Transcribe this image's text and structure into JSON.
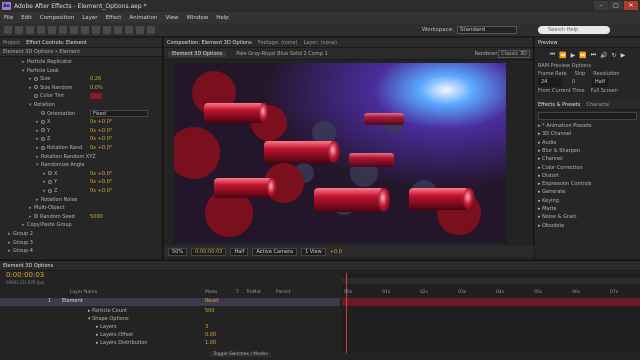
{
  "window": {
    "title": "Adobe After Effects - Element_Options.aep *",
    "logo": "Ae",
    "controls": [
      "–",
      "□",
      "✕"
    ]
  },
  "menu": [
    "File",
    "Edit",
    "Composition",
    "Layer",
    "Effect",
    "Animation",
    "View",
    "Window",
    "Help"
  ],
  "toolbar": {
    "workspace_label": "Workspace:",
    "workspace_value": "Standard",
    "search_placeholder": "Search Help"
  },
  "effect_controls": {
    "tabs": [
      "Project",
      "Effect Controls: Element"
    ],
    "subtitle": "Element 3D Options • Element",
    "rows": [
      {
        "label": "Particle Replicator",
        "indent": 0,
        "arrow": "▸",
        "value": ""
      },
      {
        "label": "Particle Look",
        "indent": 0,
        "arrow": "▾",
        "value": ""
      },
      {
        "label": "Size",
        "indent": 1,
        "arrow": "▸",
        "sw": true,
        "value": "0.26"
      },
      {
        "label": "Size Random",
        "indent": 1,
        "arrow": "▸",
        "sw": true,
        "value": "0.0%"
      },
      {
        "label": "Color Tint",
        "indent": 1,
        "arrow": "",
        "sw": true,
        "value": "",
        "swatch": "#8b1a22"
      },
      {
        "label": "Rotation",
        "indent": 1,
        "arrow": "▾",
        "value": ""
      },
      {
        "label": "Orientation",
        "indent": 2,
        "arrow": "",
        "sw": true,
        "value": "Fixed",
        "dropdown": true
      },
      {
        "label": "X",
        "indent": 2,
        "arrow": "▸",
        "sw": true,
        "value": "0x +0.0°"
      },
      {
        "label": "Y",
        "indent": 2,
        "arrow": "▸",
        "sw": true,
        "value": "0x +0.0°"
      },
      {
        "label": "Z",
        "indent": 2,
        "arrow": "▸",
        "sw": true,
        "value": "0x +0.0°"
      },
      {
        "label": "Rotation Rand",
        "indent": 2,
        "arrow": "▸",
        "sw": true,
        "value": "0x +0.0°"
      },
      {
        "label": "Rotation Random XYZ",
        "indent": 2,
        "arrow": "▸",
        "value": ""
      },
      {
        "label": "Randomize Angle",
        "indent": 2,
        "arrow": "▾",
        "value": ""
      },
      {
        "label": "X",
        "indent": 3,
        "arrow": "▸",
        "sw": true,
        "value": "0x +0.0°"
      },
      {
        "label": "Y",
        "indent": 3,
        "arrow": "▸",
        "sw": true,
        "value": "0x +0.0°"
      },
      {
        "label": "Z",
        "indent": 3,
        "arrow": "▸",
        "sw": true,
        "value": "0x +0.0°"
      },
      {
        "label": "Rotation Noise",
        "indent": 2,
        "arrow": "▸",
        "value": ""
      },
      {
        "label": "Multi-Object",
        "indent": 1,
        "arrow": "▸",
        "value": ""
      },
      {
        "label": "Random Seed",
        "indent": 1,
        "arrow": "▸",
        "sw": true,
        "value": "5000"
      },
      {
        "label": "Copy/Paste Group",
        "indent": 0,
        "arrow": "▸",
        "value": ""
      },
      {
        "label": "Group 2",
        "indent": -1,
        "arrow": "▸",
        "value": ""
      },
      {
        "label": "Group 3",
        "indent": -1,
        "arrow": "▸",
        "value": ""
      },
      {
        "label": "Group 4",
        "indent": -1,
        "arrow": "▸",
        "value": ""
      }
    ]
  },
  "composition": {
    "tabs": [
      "Composition: Element 3D Options",
      "Footage: (none)",
      "Layer: (none)"
    ],
    "subtabs": [
      "Element 3D Options",
      "Pale Gray-Royal Blue Solid 2 Comp 1"
    ],
    "renderer_label": "Renderer:",
    "renderer_value": "Classic 3D",
    "footer": {
      "zoom": "50%",
      "timecode": "0:00:00:03",
      "resolution": "Half",
      "camera": "Active Camera",
      "views": "1 View",
      "exposure": "+0.0"
    }
  },
  "preview": {
    "title": "Preview",
    "ram_options": "RAM Preview Options",
    "frame_rate_label": "Frame Rate",
    "skip_label": "Skip",
    "resolution_label": "Resolution",
    "frame_rate_value": "24",
    "skip_value": "0",
    "resolution_value": "Half",
    "from_current": "From Current Time",
    "full_screen": "Full Screen"
  },
  "effects_presets": {
    "tabs": [
      "Effects & Presets",
      "Characte"
    ],
    "items": [
      "* Animation Presets",
      "3D Channel",
      "Audio",
      "Blur & Sharpen",
      "Channel",
      "Color Correction",
      "Distort",
      "Expression Controls",
      "Generate",
      "Keying",
      "Matte",
      "Noise & Grain",
      "Obsolete"
    ]
  },
  "timeline": {
    "tab": "Element 3D Options",
    "timecode": "0:00:00:03",
    "fps": "00003 (23.976 fps)",
    "columns": [
      "Layer Name",
      "Mode",
      "T",
      "TrkMat",
      "Parent"
    ],
    "layer_row": {
      "num": "1",
      "name": "Element",
      "mode": "Reset",
      "parent": ""
    },
    "rows": [
      {
        "label": "Particle Count",
        "indent": 1,
        "value": "500"
      },
      {
        "label": "Shape Options",
        "indent": 1,
        "value": ""
      },
      {
        "label": "Layers",
        "indent": 2,
        "value": "3"
      },
      {
        "label": "Layers Offset",
        "indent": 2,
        "value": "0.00"
      },
      {
        "label": "Layers Distribution",
        "indent": 2,
        "value": "1.00"
      }
    ],
    "ruler": [
      "00s",
      "01s",
      "02s",
      "03s",
      "04s",
      "05s",
      "06s",
      "07s"
    ],
    "toggle_label": "Toggle Switches / Modes"
  }
}
